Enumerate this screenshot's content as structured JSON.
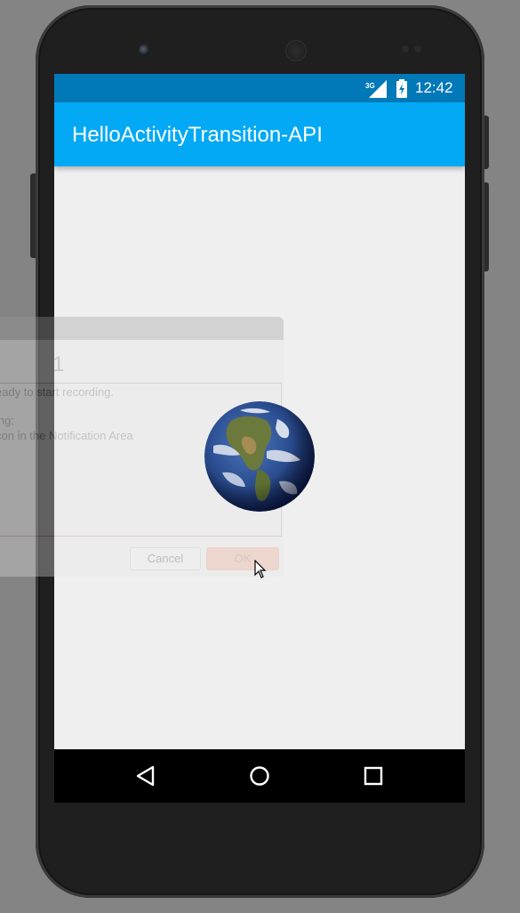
{
  "status_bar": {
    "network": "3G",
    "time": "12:42",
    "icons": [
      "signal-icon",
      "battery-icon"
    ]
  },
  "app_bar": {
    "title": "HelloActivityTransition-API"
  },
  "ghost_dialog": {
    "heading": "1",
    "lines": [
      "eady to start recording.",
      "ing:",
      "con in the Notification Area"
    ],
    "cancel_label": "Cancel",
    "ok_label": "OK"
  },
  "image": {
    "icon": "earth-globe-image"
  },
  "nav_bar": {
    "buttons": [
      "back-icon",
      "home-icon",
      "recents-icon"
    ]
  },
  "colors": {
    "status_bar": "#0179b8",
    "app_bar": "#03a9f4",
    "background": "#efefef",
    "nav_bar": "#000000"
  }
}
